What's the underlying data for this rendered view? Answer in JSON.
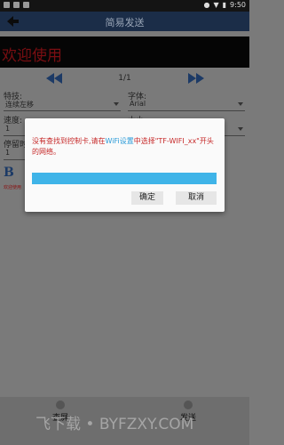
{
  "statusbar": {
    "time": "9:50"
  },
  "appbar": {
    "title": "简易发送"
  },
  "banner": {
    "text": "欢迎使用"
  },
  "pager": {
    "page": "1/1"
  },
  "form": {
    "effect_label": "特技:",
    "effect_value": "连续左移",
    "font_label": "字体:",
    "font_value": "Arial",
    "speed_label": "速度:",
    "speed_value": "1",
    "size_label": "大小",
    "stay_label": "停留时",
    "stay_value": "1",
    "bold_glyph": "B",
    "small_text": "欢迎使用"
  },
  "dialog": {
    "message_part1": "没有查找到控制卡,请在",
    "message_link": "WiFi设置",
    "message_part2": "中选择\"TF-WIFI_xx\"开头的网络。",
    "progress": 1.0,
    "confirm_label": "确定",
    "cancel_label": "取消"
  },
  "bottombar": {
    "left_label": "查屏",
    "right_label": "发送"
  },
  "watermark": {
    "text": "飞下载 • BYFZXY.COM"
  },
  "colors": {
    "appbar": "#1b2d48",
    "banner_text": "#7a0e12",
    "progress": "#3fb4e8",
    "dialog_text": "#c62828",
    "link": "#2a9bd8"
  }
}
